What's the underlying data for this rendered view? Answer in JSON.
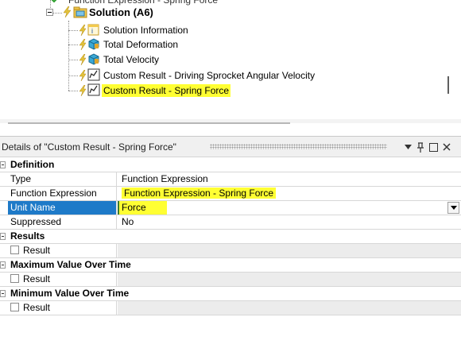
{
  "tree": {
    "solution_label": "Solution (A6)",
    "items": [
      {
        "label": "Solution Information",
        "icon": "solution-info-icon"
      },
      {
        "label": "Total Deformation",
        "icon": "deformation-result-icon"
      },
      {
        "label": "Total Velocity",
        "icon": "velocity-result-icon"
      },
      {
        "label": "Custom Result - Driving Sprocket Angular Velocity",
        "icon": "custom-result-icon"
      },
      {
        "label": "Custom Result - Spring Force",
        "icon": "custom-result-icon",
        "selected": true
      }
    ]
  },
  "details": {
    "title": "Details of \"Custom Result - Spring Force\"",
    "buttons": {
      "menu": "▼",
      "pin": "📌",
      "maximize": "□",
      "close": "✕"
    },
    "sections": {
      "definition": "Definition",
      "results": "Results",
      "max_over_time": "Maximum Value Over Time",
      "min_over_time": "Minimum Value Over Time"
    },
    "rows": {
      "type_label": "Type",
      "type_value": "Function Expression",
      "func_label": "Function Expression",
      "func_value": "Function Expression - Spring Force",
      "unit_label": "Unit Name",
      "unit_value": "Force",
      "supp_label": "Suppressed",
      "supp_value": "No",
      "result_label": "Result"
    }
  },
  "colors": {
    "highlight": "#ffff33",
    "selection": "#1e7ac8"
  }
}
